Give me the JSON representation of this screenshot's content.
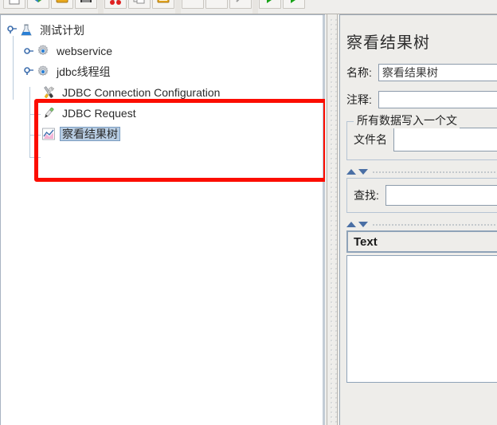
{
  "toolbar": {
    "buttons": [
      {
        "name": "new-button",
        "icon": "new-file-icon"
      },
      {
        "name": "templates-button",
        "icon": "templates-icon"
      },
      {
        "name": "open-button",
        "icon": "open-folder-icon"
      },
      {
        "name": "save-button",
        "icon": "save-icon"
      },
      {
        "name": "cut-button",
        "icon": "cut-icon"
      },
      {
        "name": "copy-button",
        "icon": "copy-icon"
      },
      {
        "name": "paste-button",
        "icon": "paste-icon"
      },
      {
        "name": "expand-button",
        "icon": "expand-icon"
      },
      {
        "name": "collapse-button",
        "icon": "collapse-icon"
      },
      {
        "name": "toggle-button",
        "icon": "toggle-icon"
      },
      {
        "name": "start-button",
        "icon": "start-play-icon"
      },
      {
        "name": "start-no-pauses-button",
        "icon": "start-no-pauses-icon"
      }
    ]
  },
  "tree": {
    "nodes": [
      {
        "label": "测试计划",
        "icon": "test-plan-flask-icon",
        "handle": "expanded",
        "depth": 0,
        "selected": false
      },
      {
        "label": "webservice",
        "icon": "thread-group-gear-icon",
        "handle": "collapsed",
        "depth": 1,
        "selected": false
      },
      {
        "label": "jdbc线程组",
        "icon": "thread-group-gear-icon",
        "handle": "expanded",
        "depth": 1,
        "selected": false
      },
      {
        "label": "JDBC Connection Configuration",
        "icon": "config-element-tools-icon",
        "handle": "none",
        "depth": 2,
        "selected": false
      },
      {
        "label": "JDBC Request",
        "icon": "sampler-pencil-icon",
        "handle": "none",
        "depth": 2,
        "selected": false
      },
      {
        "label": "察看结果树",
        "icon": "listener-chart-icon",
        "handle": "none",
        "depth": 2,
        "selected": true
      }
    ]
  },
  "annotation": {
    "name": "red-highlight-rectangle",
    "color": "#fc0d00"
  },
  "right_panel": {
    "title": "察看结果树",
    "name_label": "名称:",
    "name_value": "察看结果树",
    "comment_label": "注释:",
    "comment_value": "",
    "group_legend": "所有数据写入一个文",
    "filename_label": "文件名",
    "filename_value": "",
    "search_label": "查找:",
    "search_value": "",
    "renderer_value": "Text"
  }
}
